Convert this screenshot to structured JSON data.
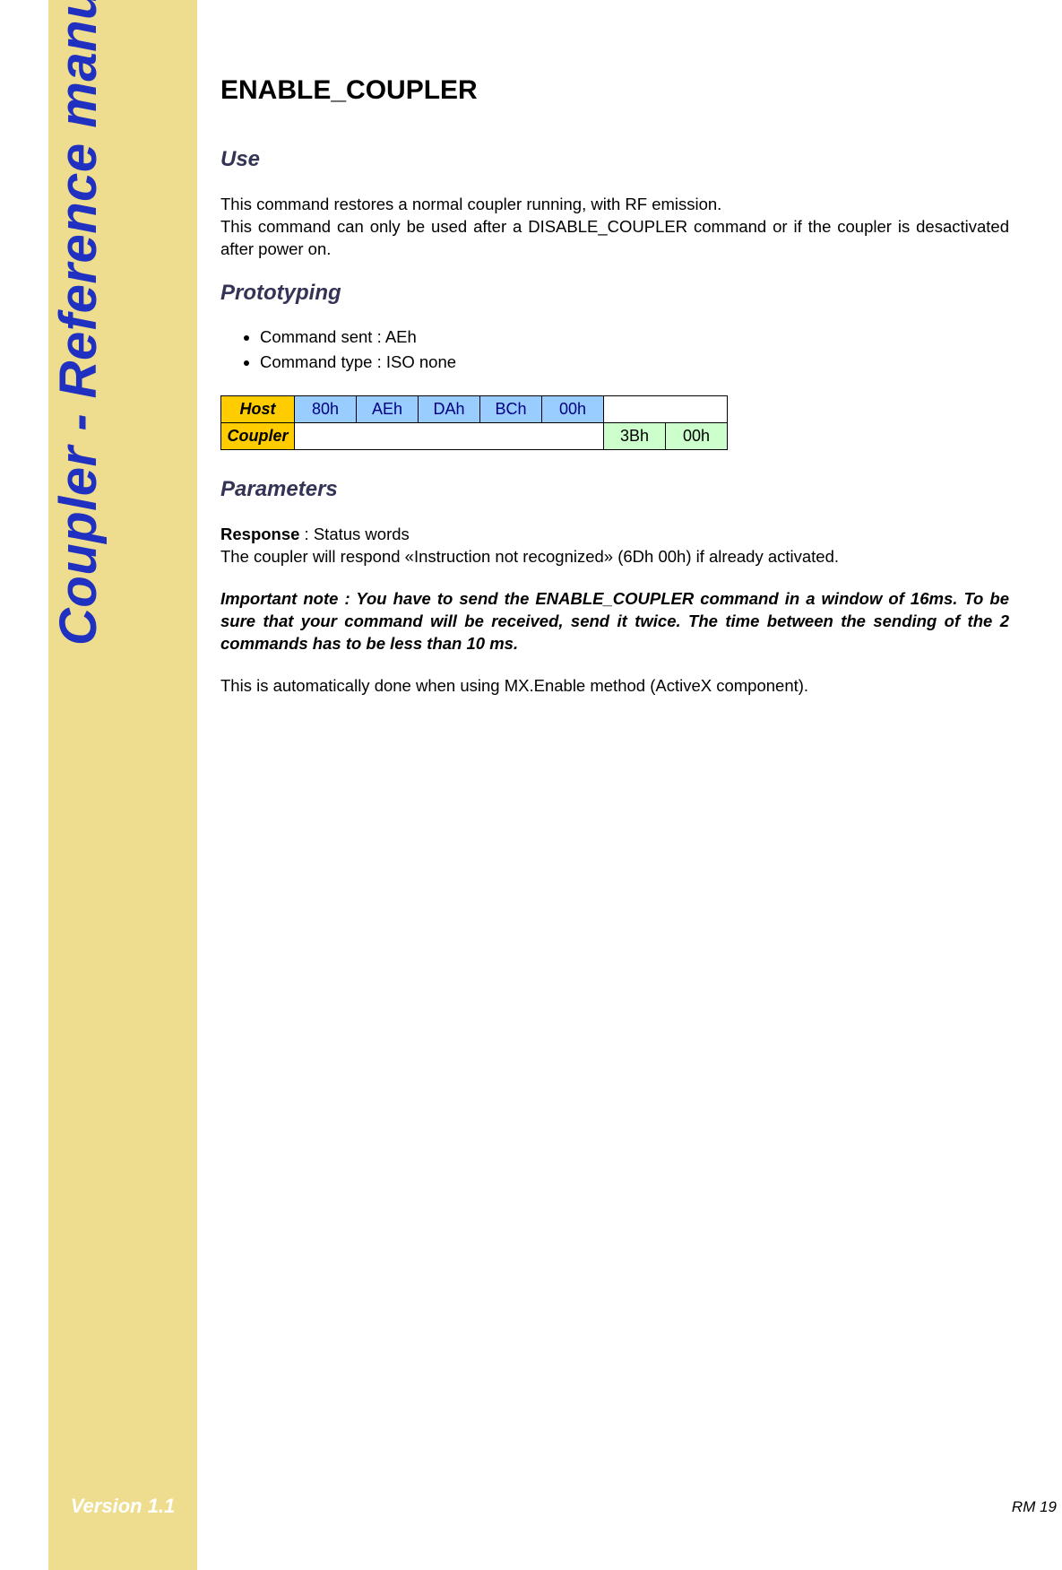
{
  "sidebar": {
    "vertical_title": "Coupler - Reference manual",
    "version": "Version 1.1"
  },
  "footer": {
    "page_number": "RM 19"
  },
  "content": {
    "title": "ENABLE_COUPLER",
    "sections": {
      "use": {
        "heading": "Use",
        "para1": "This command restores a normal coupler running, with RF emission.",
        "para2": "This command can only be used after a DISABLE_COUPLER command or if the coupler is desactivated after power on."
      },
      "prototyping": {
        "heading": "Prototyping",
        "bullets": [
          "Command sent : AEh",
          "Command type : ISO none"
        ],
        "table": {
          "host": {
            "label": "Host",
            "cells": [
              "80h",
              "AEh",
              "DAh",
              "BCh",
              "00h"
            ]
          },
          "coupler": {
            "label": "Coupler",
            "cells": [
              "3Bh",
              "00h"
            ]
          }
        }
      },
      "parameters": {
        "heading": "Parameters",
        "response_label": "Response",
        "response_text": " : Status words",
        "response_para": "The coupler will respond «Instruction not recognized» (6Dh 00h) if already activated.",
        "note": "Important note : You have to send the ENABLE_COUPLER command in a window of 16ms. To be sure that your command will be received, send it twice. The time between the sending of the 2 commands has to be less than 10 ms.",
        "auto_para": "This is automatically done when using MX.Enable method (ActiveX component)."
      }
    }
  }
}
